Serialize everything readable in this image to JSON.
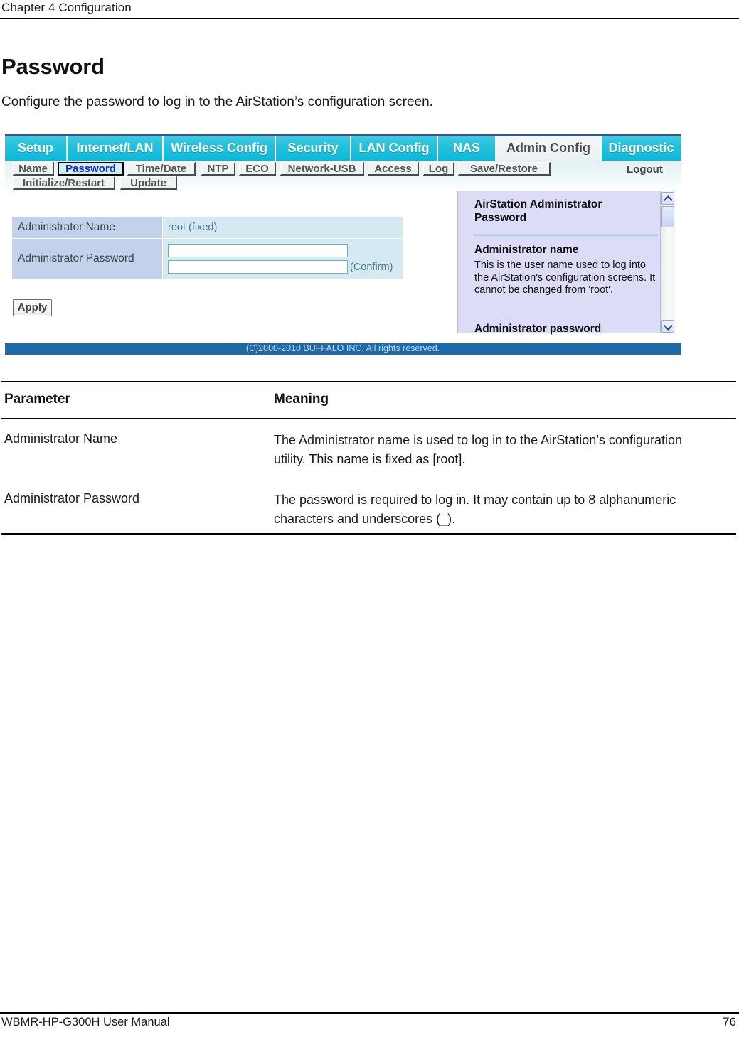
{
  "page": {
    "header": "Chapter 4  Configuration",
    "title": "Password",
    "intro": "Configure the password to log in to the AirStation’s configuration screen.",
    "footer_left": "WBMR-HP-G300H User Manual",
    "footer_page": "76"
  },
  "screenshot": {
    "main_tabs": [
      {
        "label": "Setup",
        "active": false
      },
      {
        "label": "Internet/LAN",
        "active": false
      },
      {
        "label": "Wireless Config",
        "active": false
      },
      {
        "label": "Security",
        "active": false
      },
      {
        "label": "LAN Config",
        "active": false
      },
      {
        "label": "NAS",
        "active": false
      },
      {
        "label": "Admin Config",
        "active": true
      },
      {
        "label": "Diagnostic",
        "active": false
      }
    ],
    "sub_tabs": [
      {
        "label": "Name",
        "active": false
      },
      {
        "label": "Password",
        "active": true
      },
      {
        "label": "Time/Date",
        "active": false
      },
      {
        "label": "NTP",
        "active": false
      },
      {
        "label": "ECO",
        "active": false
      },
      {
        "label": "Network-USB",
        "active": false
      },
      {
        "label": "Access",
        "active": false
      },
      {
        "label": "Log",
        "active": false
      },
      {
        "label": "Save/Restore",
        "active": false
      },
      {
        "label": "Initialize/Restart",
        "active": false
      },
      {
        "label": "Update",
        "active": false
      }
    ],
    "logout_label": "Logout",
    "form": {
      "admin_name_label": "Administrator Name",
      "admin_name_value": "root (fixed)",
      "admin_password_label": "Administrator Password",
      "password_value": "",
      "password_confirm_value": "",
      "confirm_note": "(Confirm)",
      "apply_label": "Apply"
    },
    "help": {
      "heading": "AirStation Administrator Password",
      "section1_title": "Administrator name",
      "section1_body": "This is the user name used to log into the AirStation's configuration screens. It cannot be changed from 'root'.",
      "section2_title": "Administrator password"
    },
    "copyright": "(C)2000-2010 BUFFALO INC. All rights reserved.",
    "colors": {
      "tab_cyan": "#23c0dd",
      "tab_active_bg": "#eaf1f2",
      "label_cell": "#c3d2ea",
      "value_cell": "#d5e9f2",
      "help_bg": "#dcdcf6",
      "copyright_bar": "#1e6aa8",
      "active_subtab_text": "#2020d0"
    }
  },
  "parameter_table": {
    "headers": [
      "Parameter",
      "Meaning"
    ],
    "rows": [
      {
        "parameter": "Administrator Name",
        "meaning": "The Administrator name is used to log in to the AirStation’s configuration utility. This name is fixed as [root]."
      },
      {
        "parameter": "Administrator Password",
        "meaning": "The password is required to log in.  It may contain up to 8 alphanumeric characters and underscores (_)."
      }
    ]
  }
}
